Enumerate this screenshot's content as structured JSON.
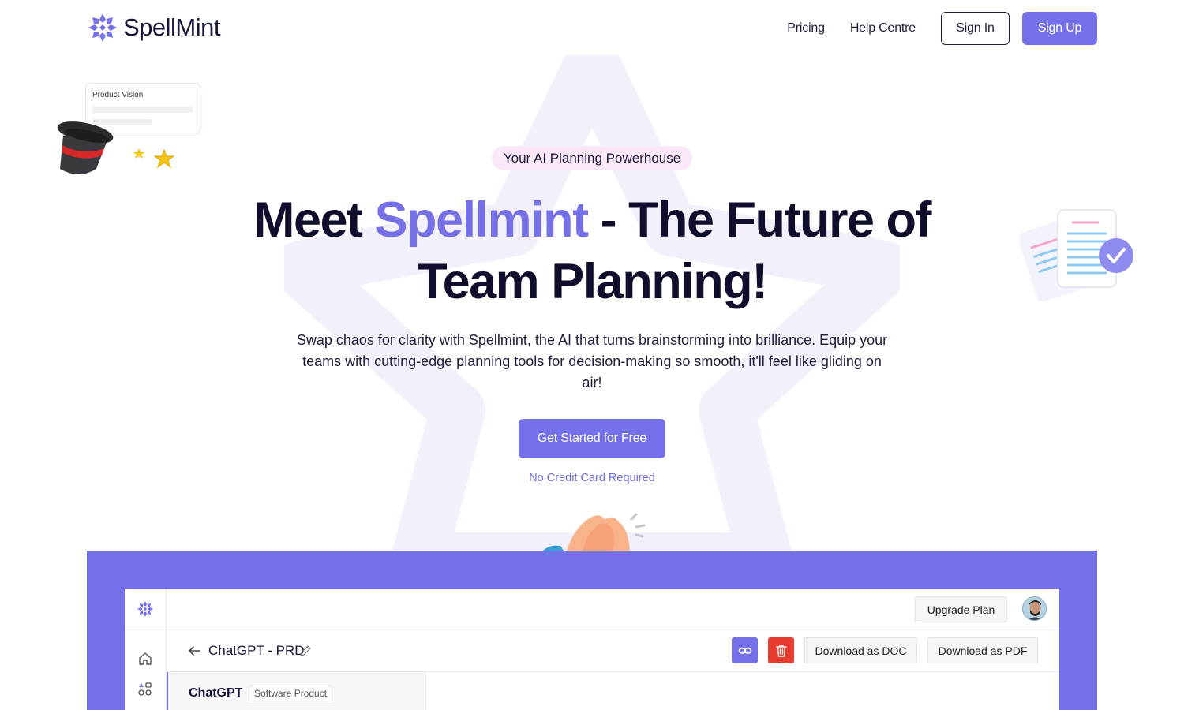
{
  "brand": {
    "name": "SpellMint",
    "accent_color": "#7370e9"
  },
  "nav": {
    "links": [
      "Pricing",
      "Help Centre"
    ],
    "sign_in": "Sign In",
    "sign_up": "Sign Up"
  },
  "decorations": {
    "card_title": "Product Vision",
    "icons": [
      "magic-hat-icon",
      "stars-icon",
      "documents-check-icon",
      "clapping-hands-icon"
    ]
  },
  "hero": {
    "badge": "Your AI Planning Powerhouse",
    "title_before": "Meet ",
    "title_accent": "Spellmint",
    "title_after": " - The Future of Team Planning!",
    "subtitle": "Swap chaos for clarity with Spellmint, the AI that turns brainstorming into brilliance. Equip your teams with cutting-edge planning tools for decision-making so smooth, it'll feel like gliding on air!",
    "cta": "Get Started for Free",
    "note": "No Credit Card Required"
  },
  "app_preview": {
    "upgrade": "Upgrade Plan",
    "doc_title": "ChatGPT - PRD",
    "download_doc": "Download as DOC",
    "download_pdf": "Download as PDF",
    "project_name": "ChatGPT",
    "project_tag": "Software Product",
    "icons": [
      "home-icon",
      "apps-icon",
      "link-icon",
      "trash-icon",
      "back-arrow-icon",
      "pencil-icon"
    ]
  }
}
